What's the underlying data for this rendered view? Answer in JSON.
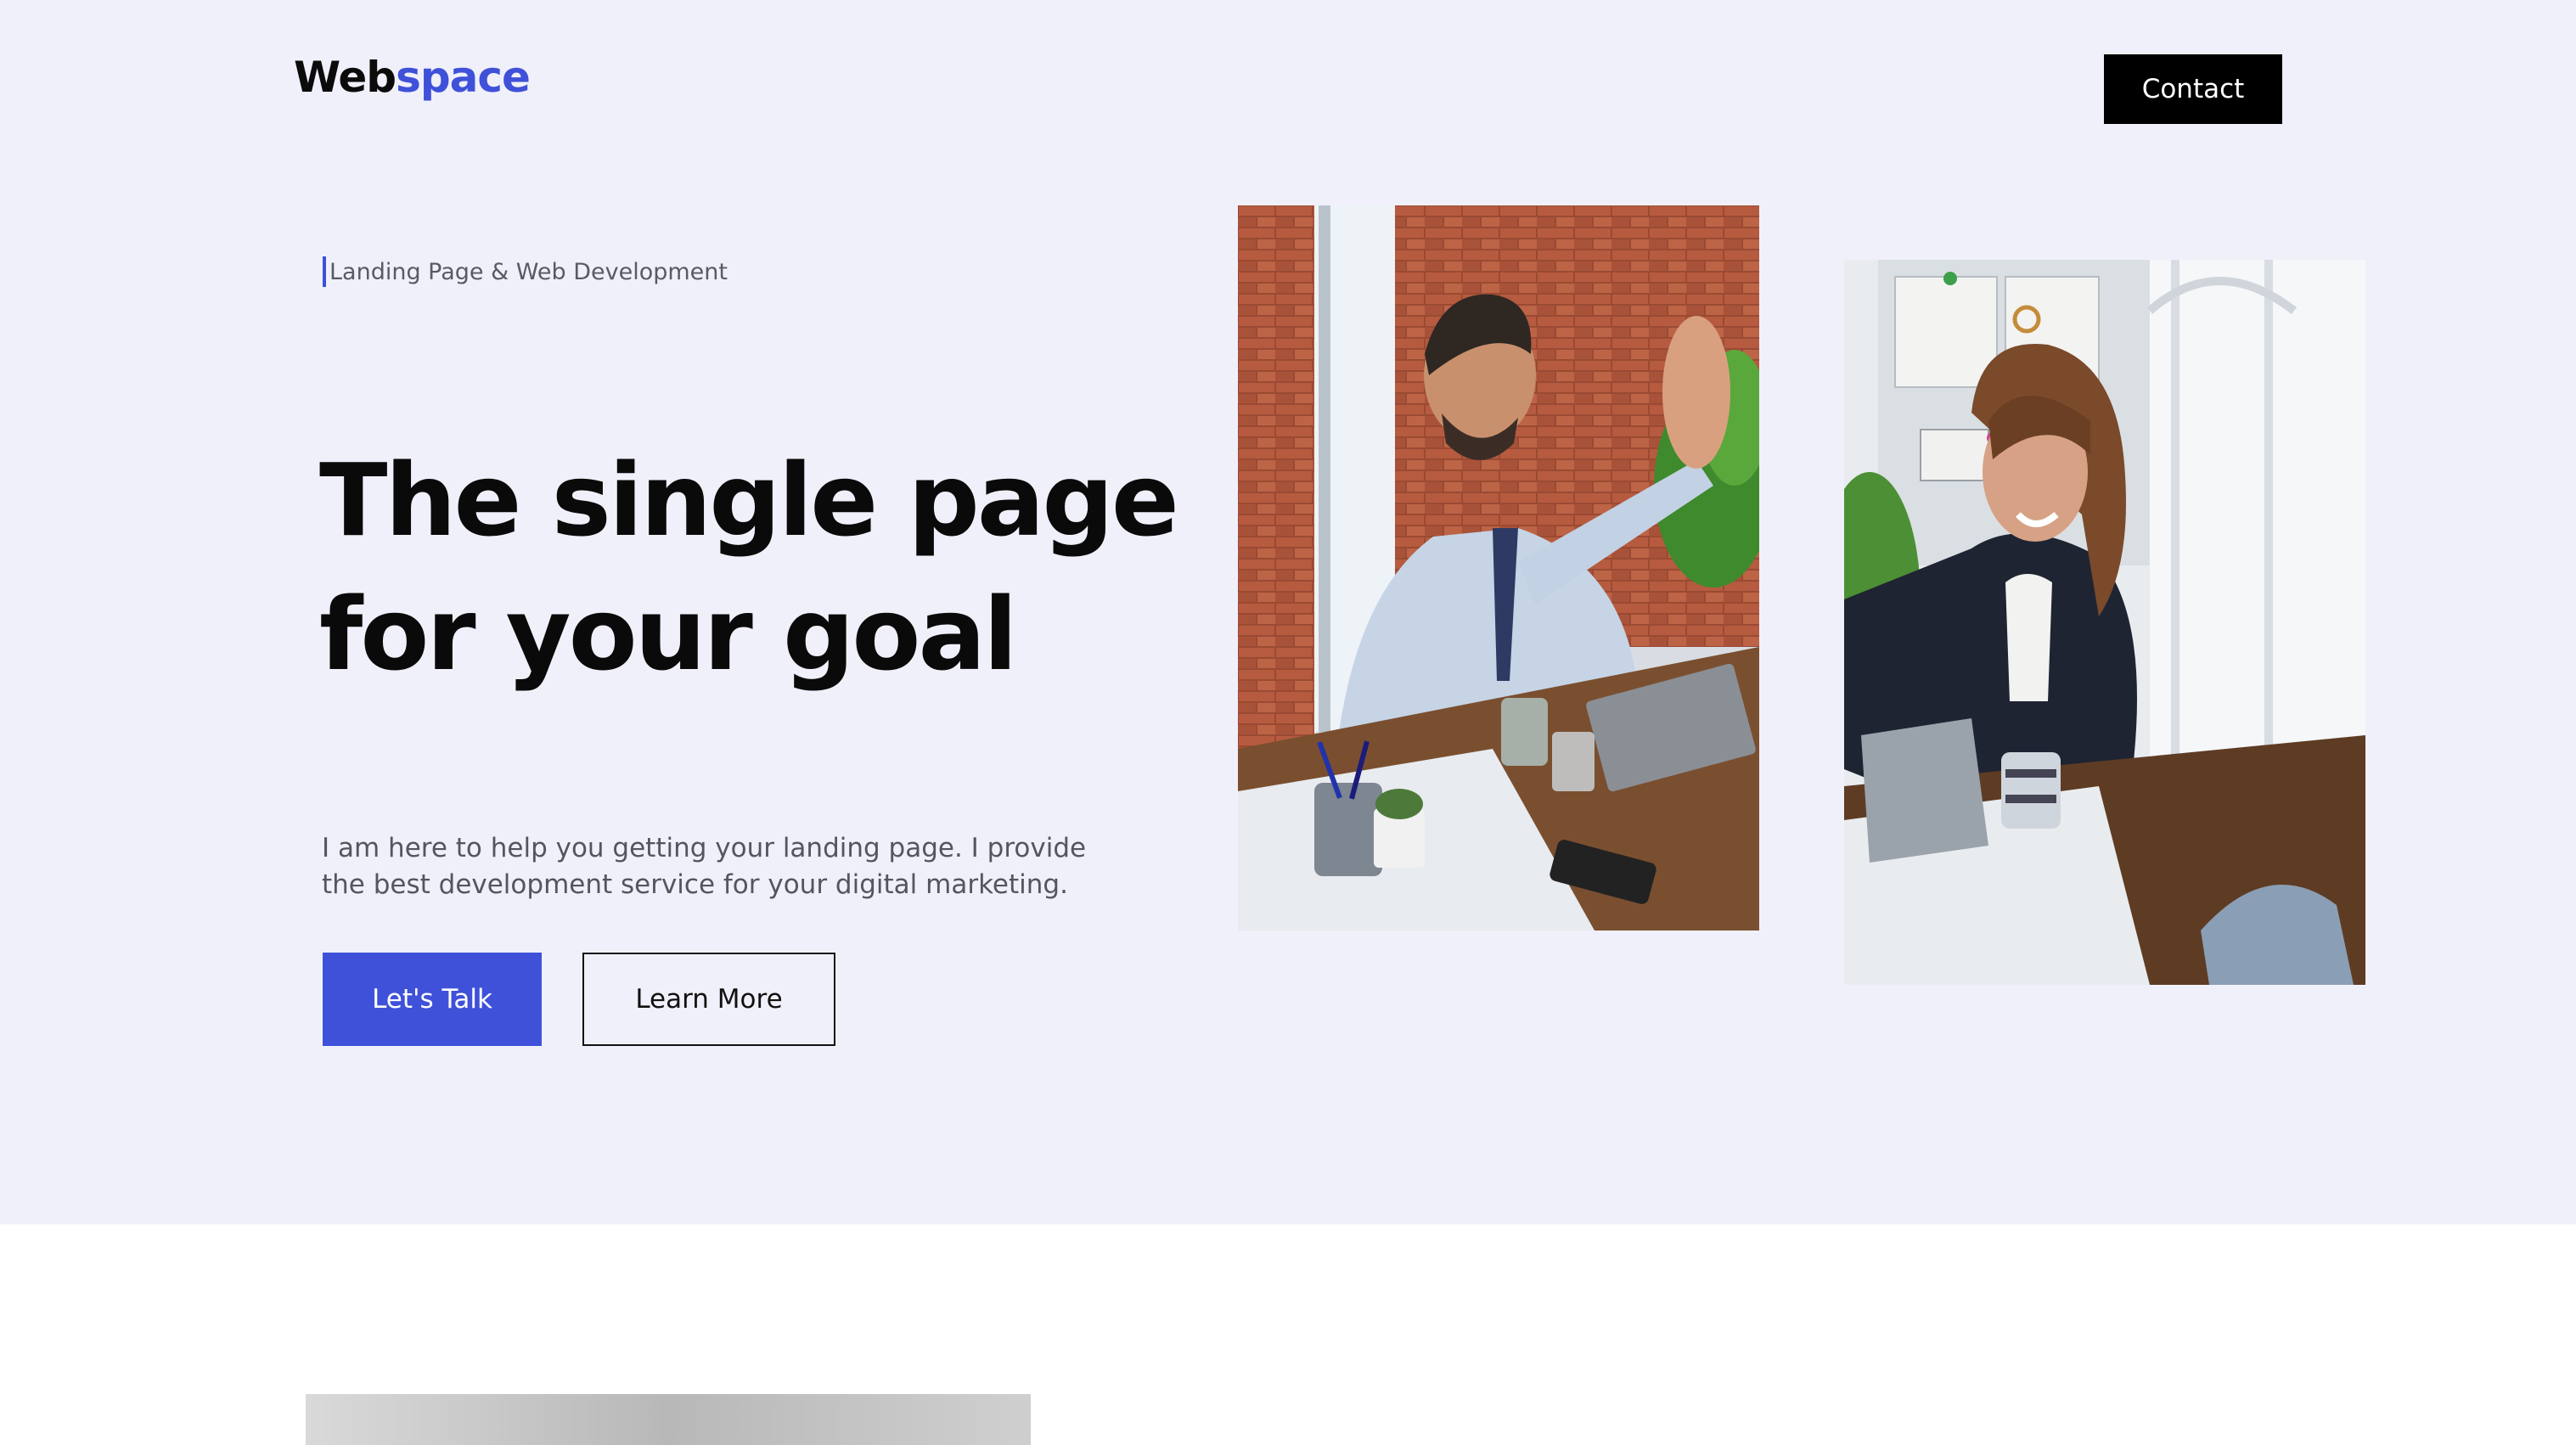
{
  "header": {
    "logo_primary": "Web",
    "logo_accent": "space",
    "contact_label": "Contact"
  },
  "hero": {
    "tagline": "Landing Page & Web Development",
    "headline_line1": "The single page",
    "headline_line2": "for your goal",
    "description": "I am here to help you getting your landing page. I provide the best development service for your digital marketing.",
    "primary_cta": "Let's Talk",
    "secondary_cta": "Learn More"
  },
  "images": {
    "photo_1": "man-high-five-photo",
    "photo_2": "woman-high-five-photo",
    "photo_3": "section-preview-photo"
  },
  "colors": {
    "accent": "#3f51d9",
    "hero_background": "#f0f0fa",
    "dark": "#000000"
  }
}
